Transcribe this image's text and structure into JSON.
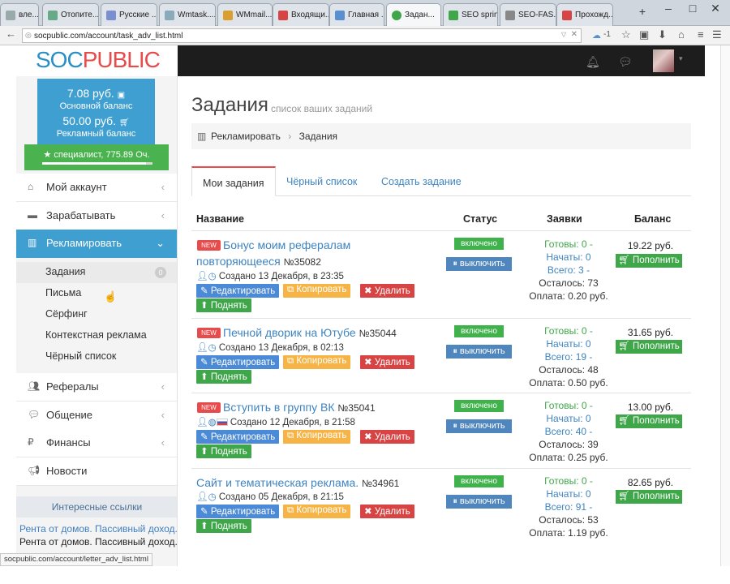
{
  "browser": {
    "tabs": [
      {
        "label": "вле...",
        "color": "#9aa"
      },
      {
        "label": "Отопите...",
        "color": "#6a8"
      },
      {
        "label": "Русские ...",
        "color": "#7a8fd0"
      },
      {
        "label": "Wmtask....",
        "color": "#8ab"
      },
      {
        "label": "WMmail....",
        "color": "#d9a030"
      },
      {
        "label": "Входящи...",
        "color": "#d84343"
      },
      {
        "label": "Главная ...",
        "color": "#5a8fd0"
      },
      {
        "label": "Задан...",
        "color": "#3fa64a"
      },
      {
        "label": "SEO sprint",
        "color": "#3fa64a"
      },
      {
        "label": "SEO-FAS...",
        "color": "#888"
      },
      {
        "label": "Прохожд...",
        "color": "#d84343"
      }
    ],
    "url": "socpublic.com/account/task_adv_list.html",
    "ext_badge": "-1",
    "status_url": "socpublic.com/account/letter_adv_list.html"
  },
  "logo": {
    "soc": "SOC",
    "pub": "PUBLIC"
  },
  "sidebar": {
    "main_balance": "7.08 руб.",
    "main_balance_label": "Основной баланс",
    "ad_balance": "50.00 руб.",
    "ad_balance_label": "Рекламный баланс",
    "rank": "специалист, 775.89 Оч.",
    "rank_progress_percent": 94,
    "menu": [
      {
        "label": "Мой аккаунт"
      },
      {
        "label": "Зарабатывать"
      },
      {
        "label": "Рекламировать"
      },
      {
        "label": "Рефералы"
      },
      {
        "label": "Общение"
      },
      {
        "label": "Финансы"
      },
      {
        "label": "Новости"
      }
    ],
    "submenu": [
      {
        "label": "Задания",
        "badge": "0"
      },
      {
        "label": "Письма"
      },
      {
        "label": "Сёрфинг"
      },
      {
        "label": "Контекстная реклама"
      },
      {
        "label": "Чёрный список"
      }
    ],
    "links_header": "Интересные ссылки",
    "link1": "Рента от домов. Пассивный доход.",
    "link2": "Рента от домов. Пассивный доход."
  },
  "main": {
    "title": "Задания",
    "subtitle": "список ваших заданий",
    "breadcrumb_root": "Рекламировать",
    "breadcrumb_current": "Задания",
    "tabs": [
      "Мои задания",
      "Чёрный список",
      "Создать задание"
    ],
    "columns": [
      "Название",
      "Статус",
      "Заявки",
      "Баланс"
    ],
    "btn_edit": "Редактировать",
    "btn_copy": "Копировать",
    "btn_delete": "Удалить",
    "btn_raise": "Поднять",
    "btn_off": "выключить",
    "btn_topup": "Пополнить",
    "status_on": "включено",
    "new_label": "NEW",
    "tasks": [
      {
        "title_l1": "Бонус моим рефералам",
        "title_l2": "повторяющееся",
        "num": "№35082",
        "created": "Создано 13 Декабря, в 23:35",
        "ready": "Готовы: 0 -",
        "started": "Начаты: 0",
        "total": "Всего: 3 -",
        "left": "Осталось: 73",
        "pay": "Оплата: 0.20 руб.",
        "balance": "19.22 руб."
      },
      {
        "title_l1": "Печной дворик на Ютубе",
        "num": "№35044",
        "created": "Создано 13 Декабря, в 02:13",
        "ready": "Готовы: 0 -",
        "started": "Начаты: 0",
        "total": "Всего: 19 -",
        "left": "Осталось: 48",
        "pay": "Оплата: 0.50 руб.",
        "balance": "31.65 руб."
      },
      {
        "title_l1": "Вступить в группу ВК",
        "num": "№35041",
        "created": "Создано 12 Декабря, в 21:58",
        "ready": "Готовы: 0 -",
        "started": "Начаты: 0",
        "total": "Всего: 40 -",
        "left": "Осталось: 39",
        "pay": "Оплата: 0.25 руб.",
        "balance": "13.00 руб."
      },
      {
        "title_l1": "Сайт и тематическая реклама.",
        "num": "№34961",
        "created": "Создано 05 Декабря, в 21:15",
        "ready": "Готовы: 0 -",
        "started": "Начаты: 0",
        "total": "Всего: 91 -",
        "left": "Осталось: 53",
        "pay": "Оплата: 1.19 руб.",
        "balance": "82.65 руб."
      }
    ]
  }
}
